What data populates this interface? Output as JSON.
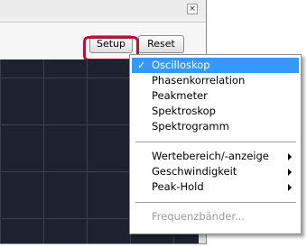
{
  "window": {
    "close_glyph": "×",
    "toolbar": {
      "setup_label": "Setup",
      "reset_label": "Reset"
    }
  },
  "menu": {
    "items": [
      {
        "label": "Oscilloskop",
        "checked": true,
        "selected": true
      },
      {
        "label": "Phasenkorrelation"
      },
      {
        "label": "Peakmeter"
      },
      {
        "label": "Spektroskop"
      },
      {
        "label": "Spektrogramm"
      },
      {
        "label": "Wertebereich/-anzeige",
        "submenu": true
      },
      {
        "label": "Geschwindigkeit",
        "submenu": true
      },
      {
        "label": "Peak-Hold",
        "submenu": true
      },
      {
        "label": "Frequenzbänder...",
        "disabled": true
      }
    ],
    "check_glyph": "✓"
  },
  "colors": {
    "highlight": "#b3153a",
    "menu_selection": "#3399ff",
    "scope_background": "#1e2230"
  }
}
